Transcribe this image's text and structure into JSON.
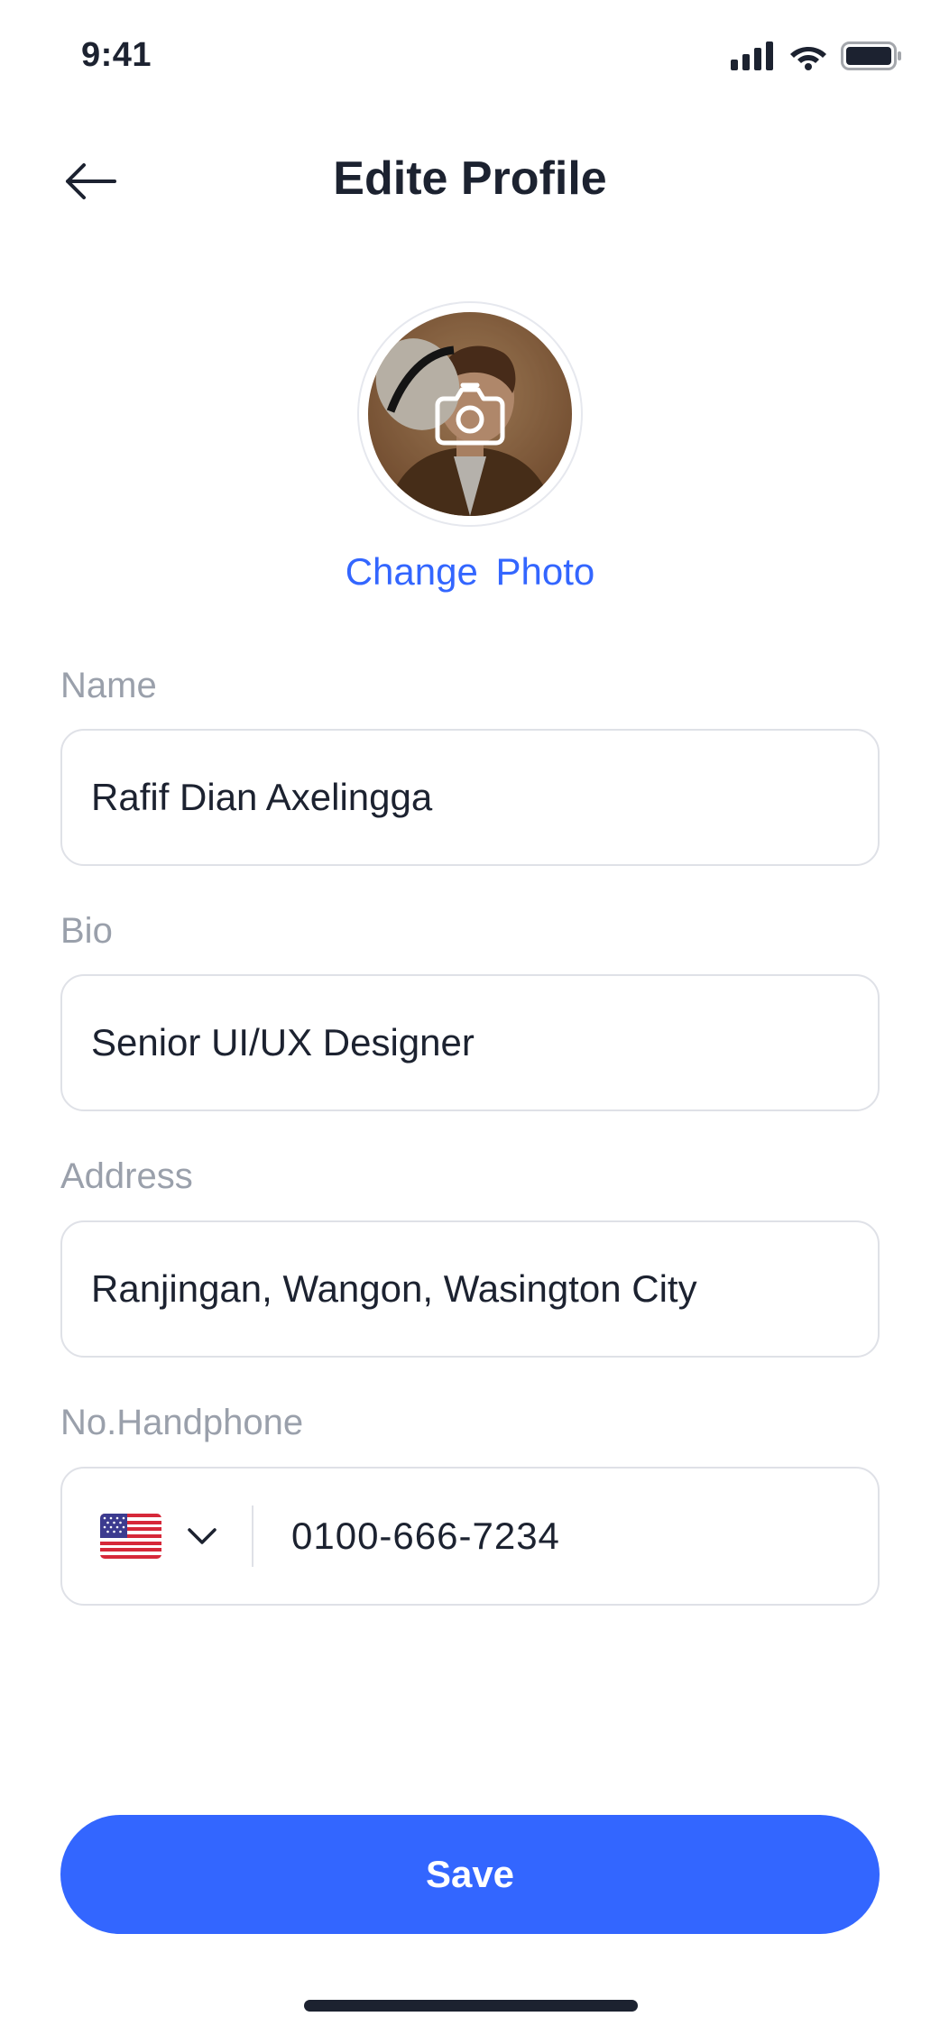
{
  "status_bar": {
    "time": "9:41"
  },
  "header": {
    "title": "Edite Profile"
  },
  "profile": {
    "change_photo_label": "Change  Photo"
  },
  "fields": {
    "name": {
      "label": "Name",
      "value": "Rafif Dian Axelingga"
    },
    "bio": {
      "label": "Bio",
      "value": "Senior UI/UX Designer"
    },
    "address": {
      "label": "Address",
      "value": "Ranjingan, Wangon, Wasington City"
    },
    "phone": {
      "label": "No.Handphone",
      "country_flag": "us-flag-icon",
      "value": "0100-666-7234"
    }
  },
  "actions": {
    "save_label": "Save"
  },
  "colors": {
    "accent": "#3366ff",
    "text": "#1c2230",
    "muted": "#9aa0ab",
    "border": "#dfe1e7"
  }
}
